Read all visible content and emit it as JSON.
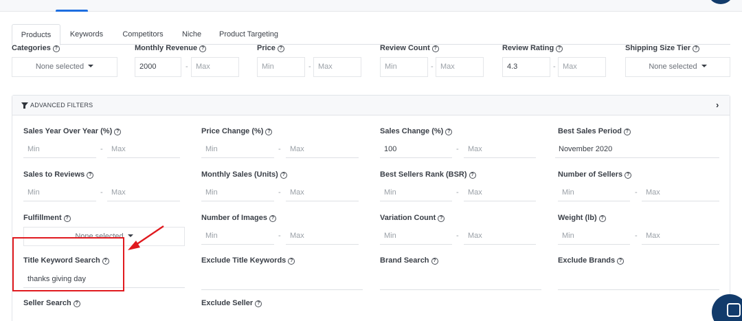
{
  "tabs": [
    "Products",
    "Keywords",
    "Competitors",
    "Niche",
    "Product Targeting"
  ],
  "top_filters": {
    "categories": {
      "label": "Categories",
      "value": "None selected"
    },
    "monthly_revenue": {
      "label": "Monthly Revenue",
      "min": "2000",
      "max": "Max"
    },
    "price": {
      "label": "Price",
      "min": "Min",
      "max": "Max"
    },
    "review_count": {
      "label": "Review Count",
      "min": "Min",
      "max": "Max"
    },
    "review_rating": {
      "label": "Review Rating",
      "min": "4.3",
      "max": "Max"
    },
    "shipping_size_tier": {
      "label": "Shipping Size Tier",
      "value": "None selected"
    }
  },
  "advanced": {
    "title": "ADVANCED FILTERS",
    "sales_yoy": {
      "label": "Sales Year Over Year (%)",
      "min": "Min",
      "max": "Max"
    },
    "price_change": {
      "label": "Price Change (%)",
      "min": "Min",
      "max": "Max"
    },
    "sales_change": {
      "label": "Sales Change (%)",
      "min": "100",
      "max": "Max"
    },
    "best_sales_period": {
      "label": "Best Sales Period",
      "value": "November 2020"
    },
    "sales_to_reviews": {
      "label": "Sales to Reviews",
      "min": "Min",
      "max": "Max"
    },
    "monthly_sales": {
      "label": "Monthly Sales (Units)",
      "min": "Min",
      "max": "Max"
    },
    "bsr": {
      "label": "Best Sellers Rank (BSR)",
      "min": "Min",
      "max": "Max"
    },
    "number_of_sellers": {
      "label": "Number of Sellers",
      "min": "Min",
      "max": "Max"
    },
    "fulfillment": {
      "label": "Fulfillment",
      "value": "None selected"
    },
    "number_of_images": {
      "label": "Number of Images",
      "min": "Min",
      "max": "Max"
    },
    "variation_count": {
      "label": "Variation Count",
      "min": "Min",
      "max": "Max"
    },
    "weight": {
      "label": "Weight (lb)",
      "min": "Min",
      "max": "Max"
    },
    "title_keyword_search": {
      "label": "Title Keyword Search",
      "value": "thanks giving day"
    },
    "exclude_title_keywords": {
      "label": "Exclude Title Keywords",
      "value": ""
    },
    "brand_search": {
      "label": "Brand Search",
      "value": ""
    },
    "exclude_brands": {
      "label": "Exclude Brands",
      "value": ""
    },
    "seller_search": {
      "label": "Seller Search"
    },
    "exclude_seller": {
      "label": "Exclude Seller"
    }
  },
  "dash": "-",
  "help_glyph": "?",
  "colors": {
    "accent": "#1d6ee0",
    "highlight": "#e0191e",
    "chat": "#123b6b"
  }
}
